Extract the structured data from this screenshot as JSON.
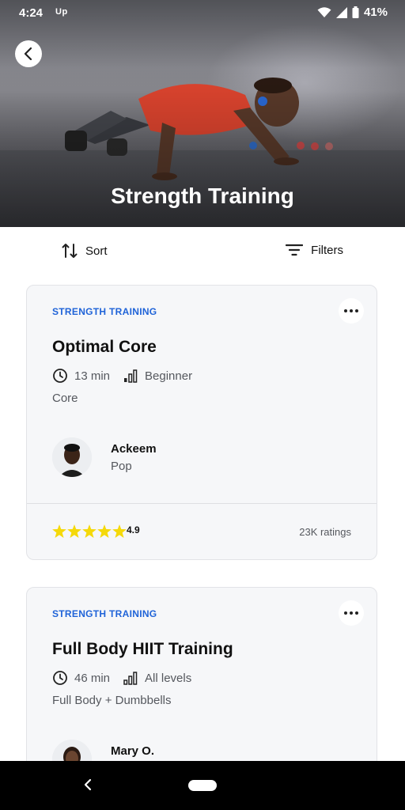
{
  "status_bar": {
    "time": "4:24",
    "app_badge": "Up",
    "battery": "41%"
  },
  "hero": {
    "title": "Strength Training"
  },
  "toolbar": {
    "sort_label": "Sort",
    "filters_label": "Filters"
  },
  "cards": [
    {
      "category": "STRENGTH TRAINING",
      "title": "Optimal Core",
      "duration": "13 min",
      "level": "Beginner",
      "focus": "Core",
      "instructor": {
        "name": "Ackeem",
        "genre": "Pop"
      },
      "rating": {
        "value": "4.9",
        "stars": 5,
        "count": "23K ratings"
      }
    },
    {
      "category": "STRENGTH TRAINING",
      "title": "Full Body HIIT Training",
      "duration": "46 min",
      "level": "All levels",
      "focus": "Full Body + Dumbbells",
      "instructor": {
        "name": "Mary O."
      }
    }
  ],
  "colors": {
    "accent": "#1f63d8",
    "star": "#f5d90a",
    "card_bg": "#f6f7f9",
    "shirt": "#e0452f"
  },
  "icons": [
    "back-arrow-icon",
    "sort-icon",
    "filter-icon",
    "more-icon",
    "clock-icon",
    "level-bars-icon",
    "star-icon",
    "wifi-icon",
    "signal-icon",
    "battery-icon",
    "nav-back-icon"
  ]
}
